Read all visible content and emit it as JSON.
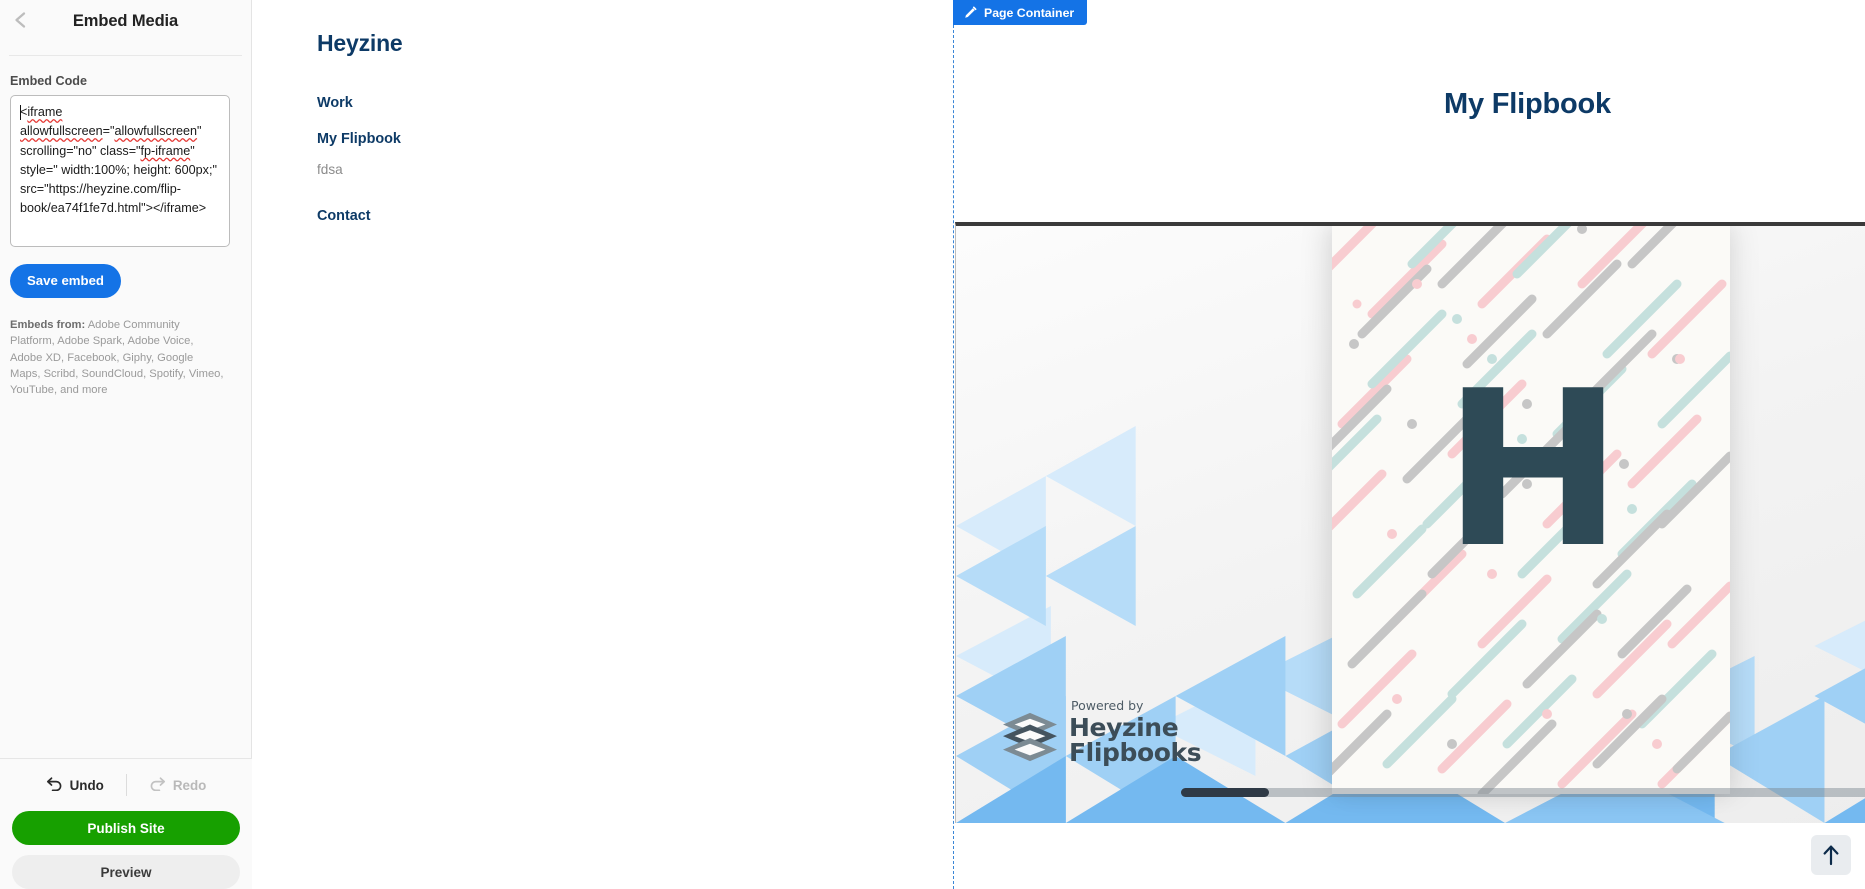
{
  "sidebar": {
    "title": "Embed Media",
    "back_icon": "chevron-left-icon",
    "embed_code_label": "Embed Code",
    "embed_code_value": "<iframe allowfullscreen=\"allowfullscreen\" scrolling=\"no\" class=\"fp-iframe\" style=\" width:100%; height: 600px;\" src=\"https://heyzine.com/flip-book/ea74f1fe7d.html\"></iframe>",
    "embed_code_parts": {
      "p1_open": "<",
      "p1_iframe": "iframe",
      "p2": " ",
      "p3_allowfullscreen_attr": "allowfullscreen",
      "p4_eq": "=\"",
      "p5_allowfullscreen_val": "allowfullscreen",
      "p6": "\" scrolling=\"no\" class=\"",
      "p7_fpiframe": "fp-iframe",
      "p8": "\" style=\" width:100%; height: 600px;\" src=\"https://heyzine.com/flip-book/ea74f1fe7d.html\"></iframe>"
    },
    "save_embed_label": "Save embed",
    "embeds_from_label": "Embeds from:",
    "embeds_from_list": " Adobe Community Platform, Adobe Spark, Adobe Voice, Adobe XD, Facebook, Giphy, Google Maps, Scribd, SoundCloud, Spotify, Vimeo, YouTube, and more",
    "undo_label": "Undo",
    "redo_label": "Redo",
    "publish_label": "Publish Site",
    "preview_label": "Preview",
    "accent_blue": "#1473e6",
    "publish_green": "#17a000"
  },
  "site": {
    "logo": "Heyzine",
    "nav": [
      {
        "label": "Work",
        "sub": false
      },
      {
        "label": "My Flipbook",
        "sub": false
      },
      {
        "label": "fdsa",
        "sub": true
      },
      {
        "label": "Contact",
        "sub": false
      }
    ],
    "nav_color": "#0d3a66"
  },
  "canvas": {
    "page_container_badge": "Page Container",
    "page_container_icon": "pencil-icon",
    "page_title": "My Flipbook",
    "selection_color": "#3a86d6"
  },
  "flipbook": {
    "cover_letter": "H",
    "download_icon": "cloud-download-icon",
    "zoom_in_icon": "zoom-in-icon",
    "watermark_powered": "Powered by",
    "watermark_brand_line1": "Heyzine",
    "watermark_brand_line2": "Flipbooks",
    "watermark_logo_icon": "heyzine-layers-logo-icon",
    "slider_position_percent": 10,
    "cover_colors": {
      "paper": "#fbfaf7",
      "pink": "#f8ccd0",
      "mint": "#c5e0dd",
      "gray": "#c6c6c6",
      "letter": "#2e4a56"
    },
    "background_colors": {
      "light": "#ffffff",
      "blue_pale": "#d7ebfb",
      "blue_mid": "#9fd0f5",
      "blue_strong": "#74b9f0"
    }
  },
  "scroll_top": {
    "icon": "arrow-up-icon",
    "label": ""
  }
}
